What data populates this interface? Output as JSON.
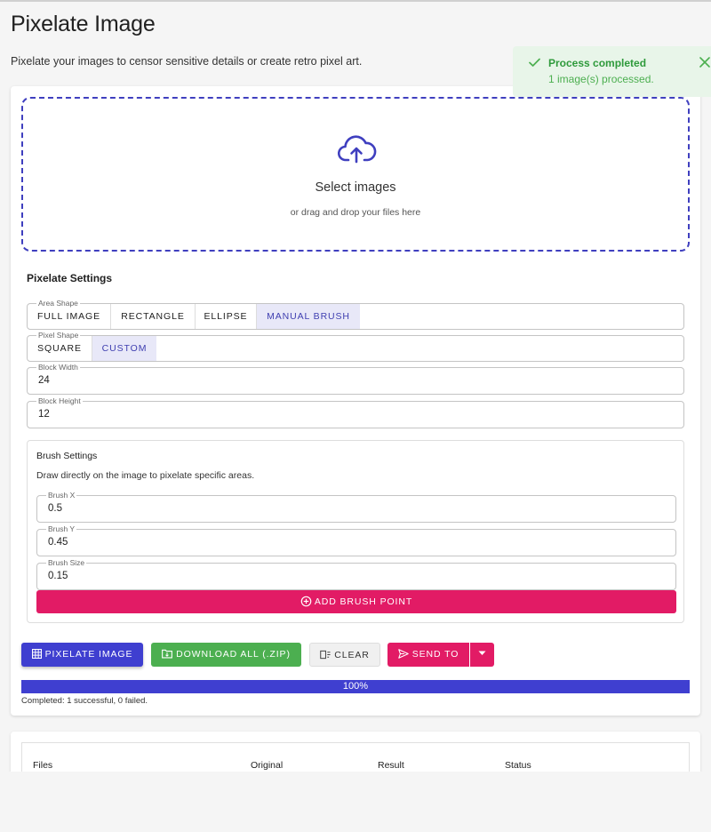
{
  "page": {
    "title": "Pixelate Image",
    "description": "Pixelate your images to censor sensitive details or create retro pixel art."
  },
  "dropzone": {
    "title": "Select images",
    "subtitle": "or drag and drop your files here"
  },
  "settings": {
    "title": "Pixelate Settings",
    "area_shape": {
      "label": "Area Shape",
      "options": [
        "FULL IMAGE",
        "RECTANGLE",
        "ELLIPSE",
        "MANUAL BRUSH"
      ],
      "selected": "MANUAL BRUSH"
    },
    "pixel_shape": {
      "label": "Pixel Shape",
      "options": [
        "SQUARE",
        "CUSTOM"
      ],
      "selected": "CUSTOM"
    },
    "block_width": {
      "label": "Block Width",
      "value": "24"
    },
    "block_height": {
      "label": "Block Height",
      "value": "12"
    }
  },
  "brush": {
    "title": "Brush Settings",
    "description": "Draw directly on the image to pixelate specific areas.",
    "brush_x": {
      "label": "Brush X",
      "value": "0.5"
    },
    "brush_y": {
      "label": "Brush Y",
      "value": "0.45"
    },
    "brush_size": {
      "label": "Brush Size",
      "value": "0.15"
    },
    "add_label": "ADD BRUSH POINT"
  },
  "actions": {
    "pixelate": "PIXELATE IMAGE",
    "download": "DOWNLOAD ALL (.ZIP)",
    "clear": "CLEAR",
    "send_to": "SEND TO"
  },
  "progress": {
    "percent": 100,
    "label": "100%",
    "status": "Completed: 1 successful, 0 failed."
  },
  "table": {
    "columns": [
      "Files",
      "Original",
      "Result",
      "Status"
    ]
  },
  "toast": {
    "title": "Process completed",
    "message": "1 image(s) processed."
  },
  "colors": {
    "primary": "#3f3fd0",
    "success": "#4caf50",
    "accent": "#e21b65"
  }
}
